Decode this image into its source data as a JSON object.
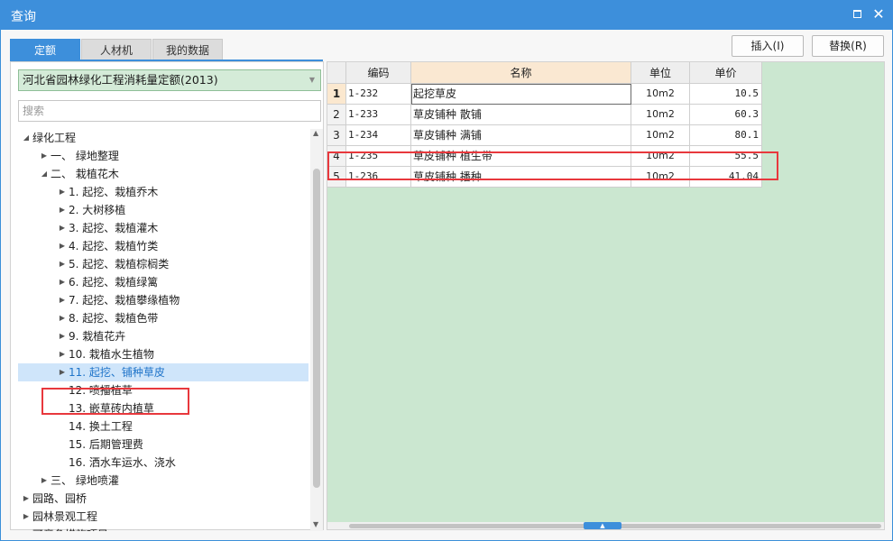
{
  "window": {
    "title": "查询"
  },
  "tabs": [
    {
      "label": "定额",
      "active": true
    },
    {
      "label": "人材机",
      "active": false
    },
    {
      "label": "我的数据",
      "active": false
    }
  ],
  "toolbar": {
    "insert_label": "插入(I)",
    "replace_label": "替换(R)"
  },
  "library": {
    "selected": "河北省园林绿化工程消耗量定额(2013)"
  },
  "search": {
    "placeholder": "搜索",
    "value": ""
  },
  "tree": [
    {
      "label": "绿化工程",
      "state": "expanded"
    },
    {
      "label": "一、 绿地整理",
      "state": "collapsed"
    },
    {
      "label": "二、 栽植花木",
      "state": "expanded"
    },
    {
      "label": "1. 起挖、栽植乔木",
      "state": "collapsed"
    },
    {
      "label": "2. 大树移植",
      "state": "collapsed"
    },
    {
      "label": "3. 起挖、栽植灌木",
      "state": "collapsed"
    },
    {
      "label": "4. 起挖、栽植竹类",
      "state": "collapsed"
    },
    {
      "label": "5. 起挖、栽植棕榈类",
      "state": "collapsed"
    },
    {
      "label": "6. 起挖、栽植绿篱",
      "state": "collapsed"
    },
    {
      "label": "7. 起挖、栽植攀缘植物",
      "state": "collapsed"
    },
    {
      "label": "8. 起挖、栽植色带",
      "state": "collapsed"
    },
    {
      "label": "9. 栽植花卉",
      "state": "collapsed"
    },
    {
      "label": "10. 栽植水生植物",
      "state": "collapsed"
    },
    {
      "label": "11. 起挖、铺种草皮",
      "state": "collapsed",
      "selected": true
    },
    {
      "label": "12. 喷播植草",
      "state": "leaf"
    },
    {
      "label": "13. 嵌草砖内植草",
      "state": "leaf"
    },
    {
      "label": "14. 换土工程",
      "state": "leaf"
    },
    {
      "label": "15. 后期管理费",
      "state": "leaf"
    },
    {
      "label": "16. 洒水车运水、浇水",
      "state": "leaf"
    },
    {
      "label": "三、 绿地喷灌",
      "state": "collapsed"
    },
    {
      "label": "园路、园桥",
      "state": "collapsed"
    },
    {
      "label": "园林景观工程",
      "state": "collapsed"
    },
    {
      "label": "可竞争措施项目",
      "state": "collapsed"
    }
  ],
  "table": {
    "columns": [
      "",
      "编码",
      "名称",
      "单位",
      "单价"
    ],
    "rows": [
      {
        "no": "1",
        "code": "1-232",
        "name": "起挖草皮",
        "unit": "10m2",
        "price": "10.5"
      },
      {
        "no": "2",
        "code": "1-233",
        "name": "草皮铺种 散铺",
        "unit": "10m2",
        "price": "60.3"
      },
      {
        "no": "3",
        "code": "1-234",
        "name": "草皮铺种 满铺",
        "unit": "10m2",
        "price": "80.1"
      },
      {
        "no": "4",
        "code": "1-235",
        "name": "草皮铺种 植生带",
        "unit": "10m2",
        "price": "55.5"
      },
      {
        "no": "5",
        "code": "1-236",
        "name": "草皮铺种 播种",
        "unit": "10m2",
        "price": "41.04"
      }
    ]
  },
  "colors": {
    "accent": "#3d8fdb",
    "grid_background": "#cbe7d0",
    "highlight": "#e8383d"
  }
}
